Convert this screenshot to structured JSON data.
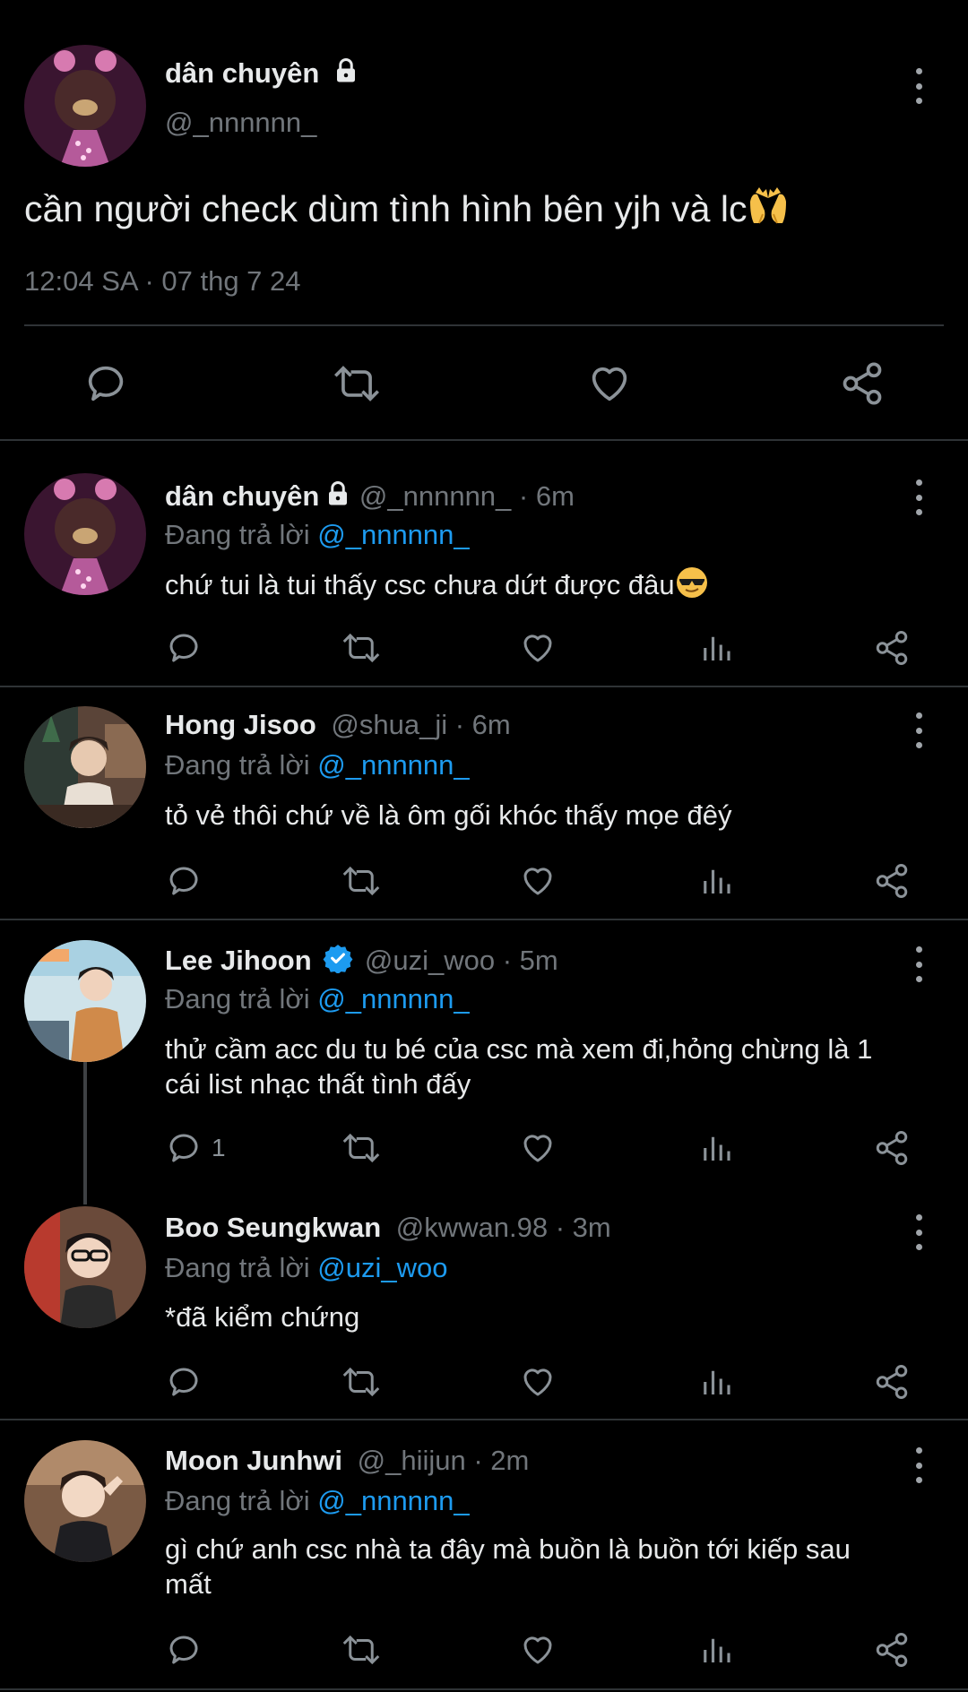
{
  "main_tweet": {
    "display_name": "dân chuyên",
    "handle": "@_nnnnnn_",
    "text": "cần người check dùm tình hình bên yjh và lc",
    "emoji": "palms-up-together",
    "timestamp": "12:04 SA · 07 thg 7 24"
  },
  "replies": [
    {
      "display_name": "dân chuyên",
      "handle": "@_nnnnnn_",
      "time": "· 6m",
      "replying_label": "Đang trả lời",
      "replying_to": "@_nnnnnn_",
      "text": "chứ tui là tui thấy csc chưa dứt được đâu",
      "emoji": "smiling-face-with-sunglasses",
      "reply_count": ""
    },
    {
      "display_name": "Hong Jisoo",
      "handle": "@shua_ji",
      "time": "· 6m",
      "replying_label": "Đang trả lời",
      "replying_to": "@_nnnnnn_",
      "text": "tỏ vẻ thôi chứ về là ôm gối khóc thấy mọe đêý",
      "reply_count": ""
    },
    {
      "display_name": "Lee Jihoon",
      "handle": "@uzi_woo",
      "time": "· 5m",
      "verified": true,
      "replying_label": "Đang trả lời",
      "replying_to": "@_nnnnnn_",
      "text_line1": "thử cầm acc du tu bé của csc mà xem đi,hỏng chừng là 1",
      "text_line2": "cái list nhạc thất tình đấy",
      "reply_count": "1"
    },
    {
      "display_name": "Boo Seungkwan",
      "handle": "@kwwan.98",
      "time": "· 3m",
      "replying_label": "Đang trả lời",
      "replying_to": "@uzi_woo",
      "text": "*đã kiểm chứng",
      "reply_count": ""
    },
    {
      "display_name": "Moon Junhwi",
      "handle": "@_hiijun",
      "time": "· 2m",
      "replying_label": "Đang trả lời",
      "replying_to": "@_nnnnnn_",
      "text_line1": "gì chứ anh csc nhà ta đây mà buồn là buồn tới kiếp sau",
      "text_line2": "mất",
      "reply_count": ""
    }
  ],
  "colors": {
    "background": "#000000",
    "text": "#e7e9ea",
    "muted": "#71767b",
    "link": "#1d9bf0",
    "divider": "#2f3336"
  }
}
